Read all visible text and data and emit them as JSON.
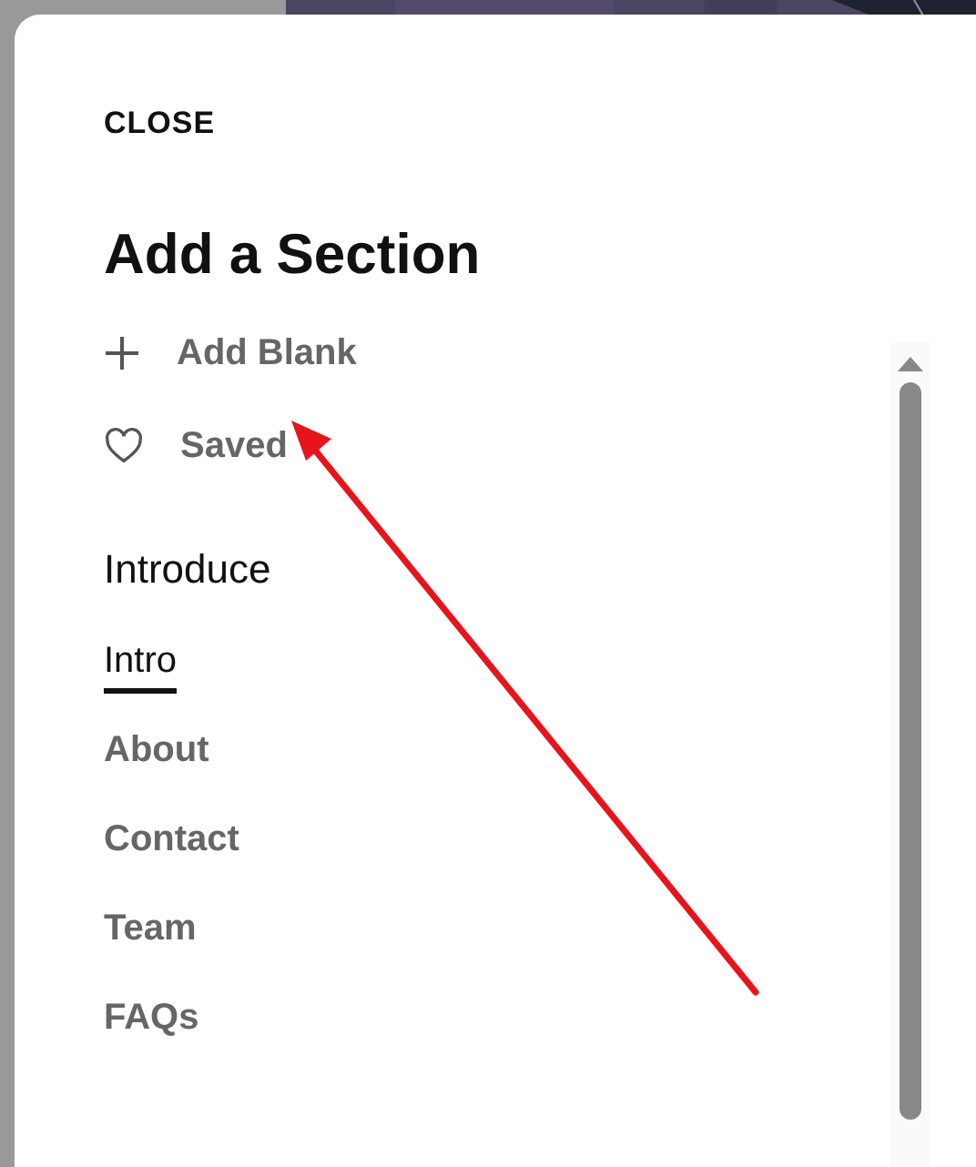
{
  "close_label": "CLOSE",
  "title": "Add a Section",
  "actions": [
    {
      "kind": "plus",
      "label": "Add Blank"
    },
    {
      "kind": "heart",
      "label": "Saved"
    }
  ],
  "category": {
    "title": "Introduce",
    "items": [
      {
        "label": "Intro",
        "selected": true
      },
      {
        "label": "About",
        "selected": false
      },
      {
        "label": "Contact",
        "selected": false
      },
      {
        "label": "Team",
        "selected": false
      },
      {
        "label": "FAQs",
        "selected": false
      }
    ]
  }
}
